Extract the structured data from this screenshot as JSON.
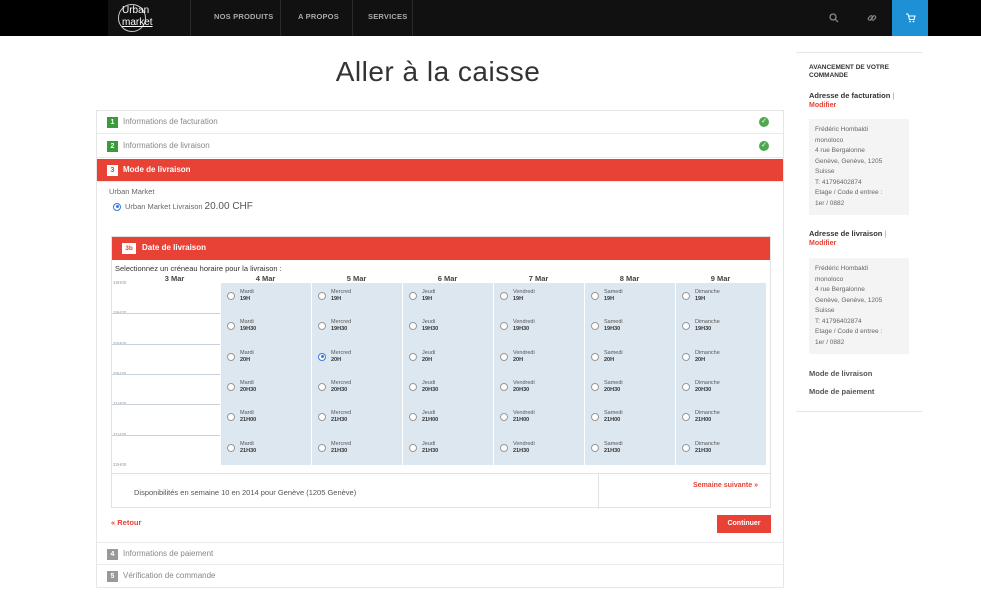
{
  "nav": {
    "logo_line1": "Urban",
    "logo_line2": "market",
    "items": [
      "NOS PRODUITS",
      "A PROPOS",
      "SERVICES"
    ],
    "search_icon": "search-icon",
    "link_icon": "link-icon",
    "cart_icon": "cart-icon",
    "cart_color": "#1e90d6"
  },
  "page": {
    "title": "Aller à la caisse"
  },
  "steps": {
    "billing": {
      "num": "1",
      "label": "Informations de facturation"
    },
    "shipping_info": {
      "num": "2",
      "label": "Informations de livraison"
    },
    "shipping_method": {
      "num": "3",
      "label": "Mode de livraison"
    },
    "payment": {
      "num": "4",
      "label": "Informations de paiement"
    },
    "review": {
      "num": "5",
      "label": "Vérification de commande"
    }
  },
  "shipping": {
    "carrier": "Urban Market",
    "option_label": "Urban Market Livraison",
    "option_price": "20.00 CHF"
  },
  "delivery_date": {
    "num": "3b",
    "title": "Date de livraison",
    "instruction": "Selectionnez un créneau horaire pour la livraison :",
    "days": [
      "3 Mar",
      "4 Mar",
      "5 Mar",
      "6 Mar",
      "7 Mar",
      "8 Mar",
      "9 Mar"
    ],
    "times": [
      "19H00",
      "19H30",
      "20H00",
      "20H30",
      "21H00",
      "21H30",
      "22H00"
    ],
    "columns": [
      {
        "day": "Mardi",
        "slots": [
          "19H",
          "19H30",
          "20H",
          "20H30",
          "21H00",
          "21H30"
        ]
      },
      {
        "day": "Mercred",
        "slots": [
          "19H",
          "19H30",
          "20H",
          "20H30",
          "21H30",
          "21H30"
        ]
      },
      {
        "day": "Jeudi",
        "slots": [
          "19H",
          "19H30",
          "20H",
          "20H30",
          "21H00",
          "21H30"
        ]
      },
      {
        "day": "Vendredi",
        "slots": [
          "19H",
          "19H30",
          "20H",
          "20H30",
          "21H00",
          "21H30"
        ]
      },
      {
        "day": "Samedi",
        "slots": [
          "19H",
          "19H30",
          "20H",
          "20H30",
          "21H00",
          "21H30"
        ]
      },
      {
        "day": "Dimanche",
        "slots": [
          "19H",
          "19H30",
          "20H",
          "20H30",
          "21H00",
          "21H30"
        ]
      }
    ],
    "selected": {
      "column": 1,
      "slot": 2
    },
    "availability": "Disponibilités en semaine 10 en 2014 pour Genève (1205 Genève)",
    "next_week": "Semaine suivante »"
  },
  "actions": {
    "back": "« Retour",
    "continue": "Continuer",
    "accent": "#e84136"
  },
  "sidebar": {
    "title": "AVANCEMENT DE VOTRE COMMANDE",
    "billing_heading": "Adresse de facturation",
    "billing_sep": "|",
    "modify": "Modifier",
    "address_lines": [
      "Frédéric Hombaldi",
      "monoloco",
      "4 rue Bergalonne",
      "Genève, Genève, 1205",
      "Suisse",
      "T: 41796402874",
      "Etage / Code d entree :",
      "1er / 0882"
    ],
    "shipping_heading": "Adresse de livraison",
    "shipping_sep": "|",
    "shipping_method": "Mode de livraison",
    "payment_method": "Mode de paiement"
  }
}
